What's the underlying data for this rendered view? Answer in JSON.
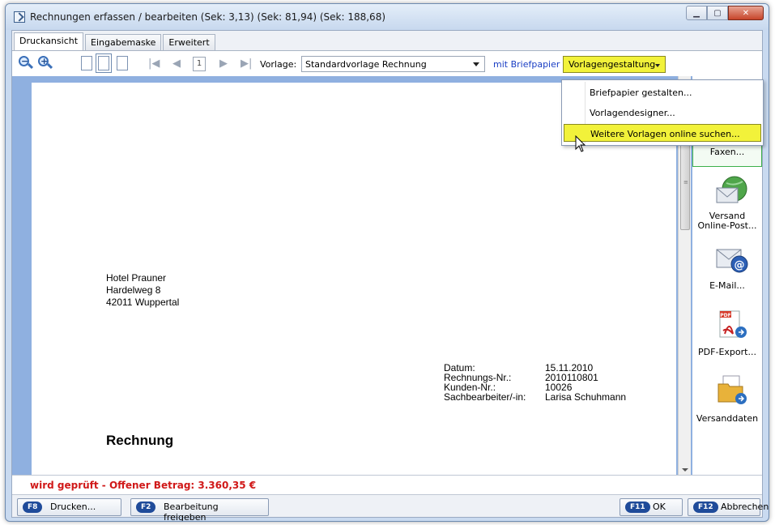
{
  "window": {
    "title": "Rechnungen erfassen / bearbeiten (Sek: 3,13) (Sek: 81,94) (Sek: 188,68)"
  },
  "tabs": [
    {
      "label": "Druckansicht",
      "active": true
    },
    {
      "label": "Eingabemaske",
      "active": false
    },
    {
      "label": "Erweitert",
      "active": false
    }
  ],
  "toolbar": {
    "page_number": "1",
    "vorlage_label": "Vorlage:",
    "vorlage_value": "Standardvorlage Rechnung",
    "briefpapier_label": "mit Briefpapier",
    "vorlagengestaltung_label": "Vorlagengestaltung"
  },
  "menu": {
    "items": [
      {
        "label": "Briefpapier gestalten..."
      },
      {
        "label": "Vorlagendesigner..."
      },
      {
        "label": "Weitere Vorlagen online suchen...",
        "highlighted": true
      }
    ]
  },
  "document": {
    "address": [
      "Hotel Prauner",
      "Hardelweg 8",
      "42011 Wuppertal"
    ],
    "meta": [
      {
        "key": "Datum:",
        "value": "15.11.2010"
      },
      {
        "key": "Rechnungs-Nr.:",
        "value": "2010110801"
      },
      {
        "key": "Kunden-Nr.:",
        "value": "10026"
      },
      {
        "key": "Sachbearbeiter/-in:",
        "value": "Larisa Schuhmann"
      }
    ],
    "heading": "Rechnung"
  },
  "actions": {
    "fax": "Faxen...",
    "versand_line1": "Versand",
    "versand_line2": "Online-Post...",
    "email": "E-Mail...",
    "pdf": "PDF-Export...",
    "versanddaten": "Versanddaten"
  },
  "status": {
    "text": "wird geprüft - Offener Betrag: 3.360,35 €"
  },
  "bottom": {
    "print_key": "F8",
    "print_label": "Drucken...",
    "release_key": "F2",
    "release_label": "Bearbeitung freigeben",
    "ok_key": "F11",
    "ok_label": "OK",
    "cancel_key": "F12",
    "cancel_label": "Abbrechen"
  },
  "colors": {
    "highlight": "#f2f23a",
    "status_red": "#d01818",
    "link_blue": "#1a3ec4",
    "doc_bg": "#8fb0e0"
  }
}
